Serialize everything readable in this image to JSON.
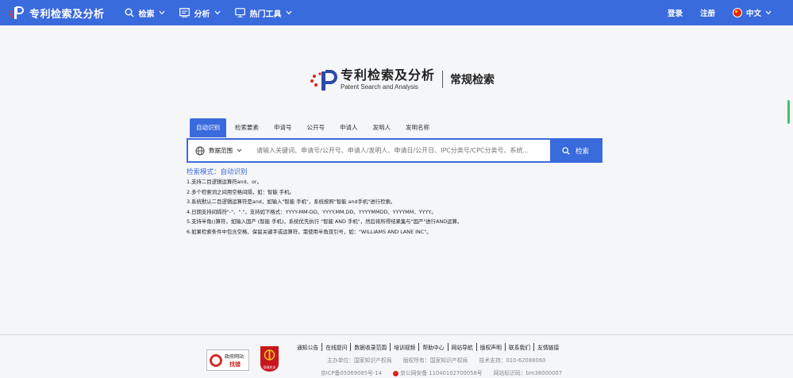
{
  "header": {
    "brand": "专利检索及分析",
    "nav": [
      {
        "label": "检索",
        "icon": "search-icon"
      },
      {
        "label": "分析",
        "icon": "analysis-icon"
      },
      {
        "label": "热门工具",
        "icon": "monitor-icon"
      }
    ],
    "login": "登录",
    "register": "注册",
    "language": "中文"
  },
  "hero": {
    "title": "专利检索及分析",
    "subtitle": "Patent Search and Analysis",
    "mode": "常规检索"
  },
  "tabs": [
    "自动识别",
    "检索要素",
    "申请号",
    "公开号",
    "申请人",
    "发明人",
    "发明名称"
  ],
  "search": {
    "scope_label": "数据范围",
    "placeholder": "请输入关键词、申请号/公开号、申请人/发明人、申请日/公开日、IPC分类号/CPC分类号、系统...",
    "button": "检索"
  },
  "mode_label": "检索模式：自动识别",
  "tips": [
    "1.支持二目逻辑运算符and、or。",
    "2.多个检索词之间用空格间隔，如：智能 手机。",
    "3.系统默认二目逻辑运算符是and，如输入\"智能 手机\"，系统按照\"智能 and手机\"进行检索。",
    "4.日期支持间隔符\"-\"、\".\"，支持如下格式：YYYY-MM-DD、YYYY.MM.DD、YYYYMMDD、YYYYMM、YYYY。",
    "5.支持半角()算符，如输入国产 (智能 手机)，系统优先执行 \"智能 AND 手机\"，然后将所得结果集与\"国产\"进行AND运算。",
    "6.如果检索条件中包含空格、保留关键字或运算符，需使用半角双引号，如：\"WILLIAMS AND LANE INC\"。"
  ],
  "footer": {
    "badge1_title": "政府网站",
    "badge1_sub": "找错",
    "badge2_text": "党政机关",
    "links": [
      "通知公告",
      "在线提问",
      "数据收录范围",
      "培训视频",
      "帮助中心",
      "网站导航",
      "版权声明",
      "联系我们",
      "友情链接"
    ],
    "sponsor": "主办单位：国家知识产权局",
    "copyright": "版权所有：国家知识产权局",
    "support": "技术支持：010-62088060",
    "icp": "京ICP备05069085号-14",
    "police": "京公网安备 11040102700058号",
    "site_code": "网站标识码：bm38000007"
  }
}
